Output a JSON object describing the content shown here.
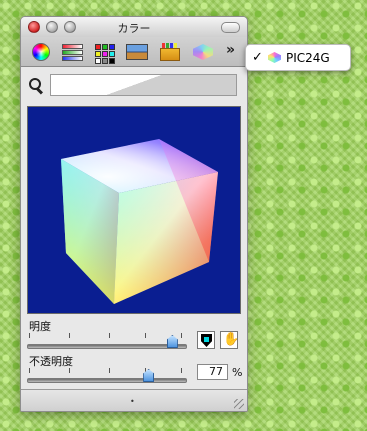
{
  "window": {
    "title": "カラー"
  },
  "toolbar": {
    "items": [
      {
        "name": "color-wheel"
      },
      {
        "name": "color-sliders"
      },
      {
        "name": "color-palettes"
      },
      {
        "name": "image-palettes"
      },
      {
        "name": "crayons"
      },
      {
        "name": "pic24g-cube"
      }
    ],
    "more_glyph": "»"
  },
  "popup_menu": {
    "check_glyph": "✓",
    "item_label": "PIC24G"
  },
  "controls": {
    "brightness": {
      "label": "明度",
      "value_fraction": 0.92
    },
    "opacity": {
      "label": "不透明度",
      "value": "77",
      "unit": "%",
      "value_fraction": 0.77
    }
  },
  "footer": {
    "grab_glyph": "•"
  },
  "colors": {
    "canvas_bg": "#0a1e91",
    "accent_thumb": "#4f95e0",
    "desktop": "#9fd35b"
  }
}
